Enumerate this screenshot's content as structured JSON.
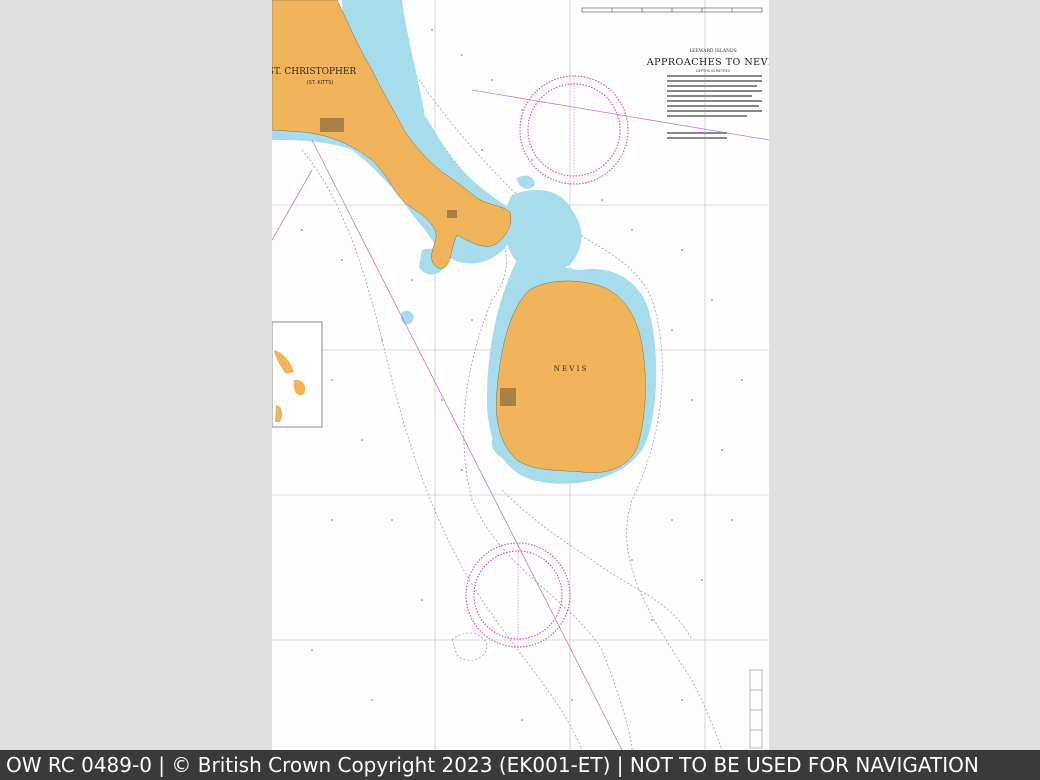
{
  "footer": {
    "text": "OW RC 0489-0 | © British Crown Copyright 2023 (EK001-ET) | NOT TO BE USED FOR NAVIGATION"
  },
  "chart": {
    "region": "LEEWARD ISLANDS",
    "title": "APPROACHES TO NEVIS",
    "subtitle": "DEPTHS IN METRES",
    "labels": {
      "st_christopher": "ST. CHRISTOPHER",
      "st_kitts": "(ST. KITTS)",
      "nevis": "N E V I S"
    }
  },
  "colors": {
    "land": "#f2b45a",
    "shallow_water": "#a7dcec",
    "deep_water": "#fdfdfd",
    "compass_rose": "#d35ad6",
    "grid": "#b9b9b9",
    "route": "#c77bd9",
    "viewer_background": "#e0e0e0",
    "footer_background": "#3a3a3a"
  }
}
